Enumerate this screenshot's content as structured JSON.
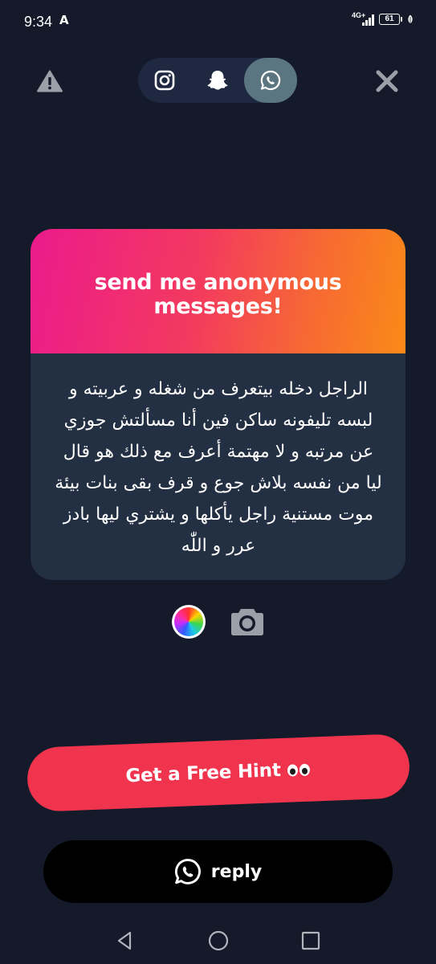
{
  "status_bar": {
    "time": "9:34",
    "extra_icon": "A",
    "network": "4G+",
    "battery": "61"
  },
  "top_bar": {
    "warning_icon": "warning-icon",
    "close_icon": "close-icon",
    "platforms": [
      {
        "name": "instagram",
        "icon": "instagram-icon",
        "active": false
      },
      {
        "name": "snapchat",
        "icon": "snapchat-icon",
        "active": false
      },
      {
        "name": "whatsapp",
        "icon": "whatsapp-icon",
        "active": true
      }
    ]
  },
  "card": {
    "title": "send me anonymous messages!",
    "message": "الراجل دخله بيتعرف من شغله و عربيته و لبسه تليفونه ساكن فين أنا مسألتش جوزي عن مرتبه و لا مهتمة أعرف مع ذلك هو قال ليا من نفسه بلاش جوع و قرف بقى بنات بيئة موت مستنية راجل يأكلها و يشتري ليها بادز عرر و اللّٰه",
    "gradient_colors": [
      "#ec1a8c",
      "#fa8a17"
    ],
    "body_color": "#232f42"
  },
  "tools": {
    "color_icon": "color-wheel-icon",
    "camera_icon": "camera-icon"
  },
  "hint_button": {
    "label": "Get a Free Hint",
    "emoji_icon": "eyes-icon",
    "color": "#f0344e"
  },
  "reply_button": {
    "label": "reply",
    "icon": "whatsapp-icon"
  },
  "nav_bar": {
    "items": [
      "back-icon",
      "home-icon",
      "recents-icon"
    ]
  }
}
